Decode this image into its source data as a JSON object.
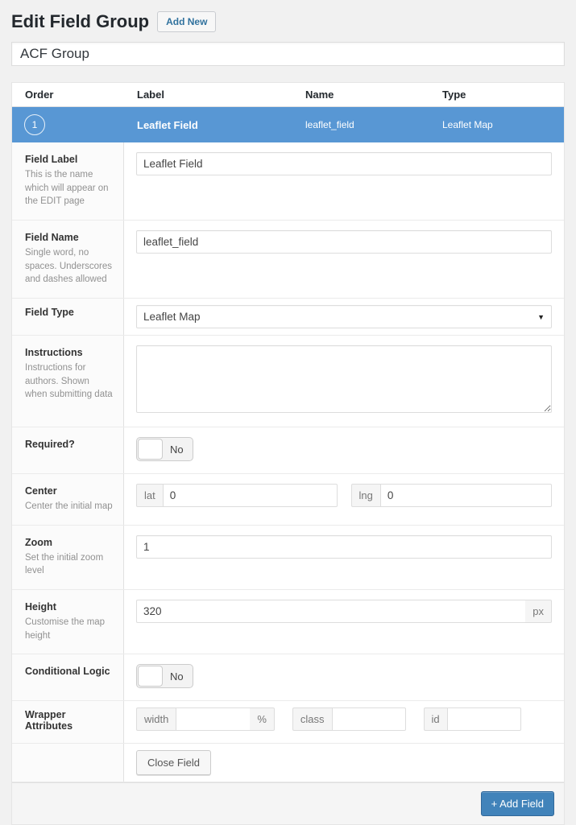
{
  "page": {
    "title": "Edit Field Group",
    "add_new_label": "Add New"
  },
  "title_field": {
    "value": "ACF Group"
  },
  "table": {
    "headers": [
      "Order",
      "Label",
      "Name",
      "Type"
    ],
    "active_row": {
      "order": "1",
      "label": "Leaflet Field",
      "name": "leaflet_field",
      "type": "Leaflet Map"
    }
  },
  "fields": {
    "field_label": {
      "label": "Field Label",
      "description": "This is the name which will appear on the EDIT page",
      "value": "Leaflet Field"
    },
    "field_name": {
      "label": "Field Name",
      "description": "Single word, no spaces. Underscores and dashes allowed",
      "value": "leaflet_field"
    },
    "field_type": {
      "label": "Field Type",
      "value": "Leaflet Map"
    },
    "instructions": {
      "label": "Instructions",
      "description": "Instructions for authors. Shown when submitting data",
      "value": ""
    },
    "required": {
      "label": "Required?",
      "value": "No"
    },
    "center": {
      "label": "Center",
      "description": "Center the initial map",
      "lat_label": "lat",
      "lat_value": "0",
      "lng_label": "lng",
      "lng_value": "0"
    },
    "zoom": {
      "label": "Zoom",
      "description": "Set the initial zoom level",
      "value": "1"
    },
    "height": {
      "label": "Height",
      "description": "Customise the map height",
      "value": "320",
      "suffix": "px"
    },
    "conditional_logic": {
      "label": "Conditional Logic",
      "value": "No"
    },
    "wrapper": {
      "label": "Wrapper Attributes",
      "width_label": "width",
      "width_value": "",
      "width_suffix": "%",
      "class_label": "class",
      "class_value": "",
      "id_label": "id",
      "id_value": ""
    },
    "close_button_label": "Close Field"
  },
  "footer": {
    "add_field_label": "+ Add Field"
  },
  "colors": {
    "active_row_blue": "#5897d4",
    "add_field_blue": "#4183ba",
    "page_background": "#f1f1f1",
    "link_blue": "#31729e"
  }
}
